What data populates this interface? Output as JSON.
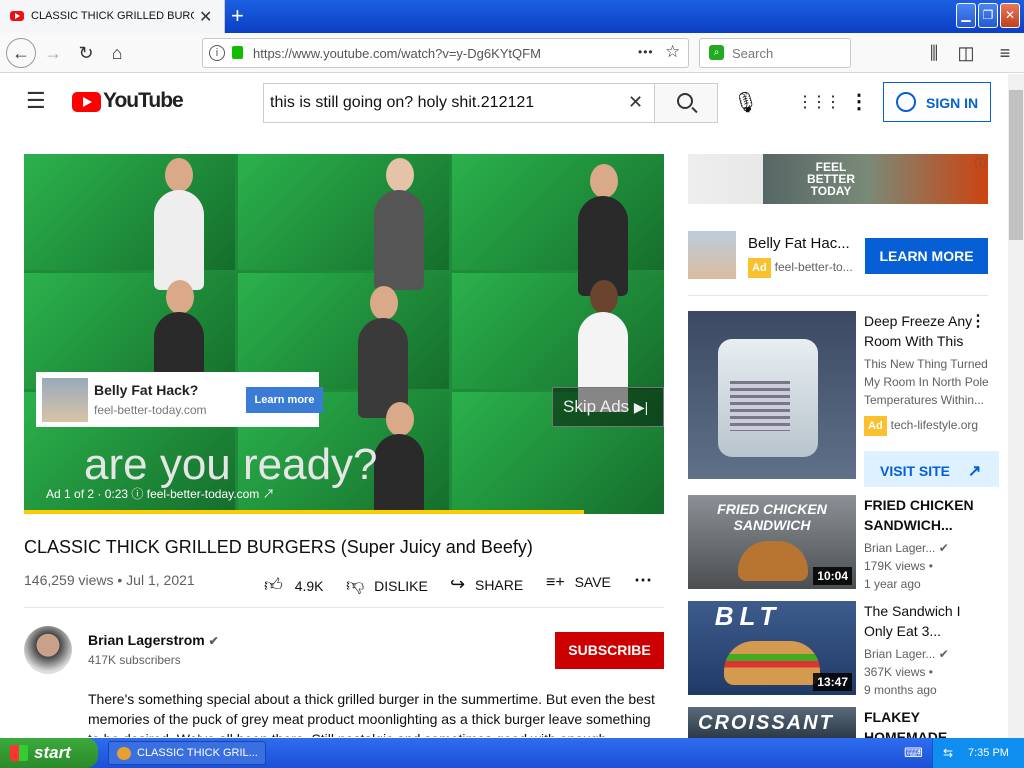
{
  "browser": {
    "tab_title": "CLASSIC THICK GRILLED BURGERS (Super Juicy and Beefy) - YouTube",
    "new_tab_icon": "+",
    "url": "https://www.youtube.com/watch?v=y-Dg6KYtQFM",
    "search_placeholder": "Search",
    "more_dots": "•••"
  },
  "youtube": {
    "logo_text": "YouTube",
    "search_query": "this is still going on? holy shit.212121",
    "sign_in": "SIGN IN"
  },
  "video_ad": {
    "card_title": "Belly Fat Hack?",
    "card_url": "feel-better-today.com",
    "card_button": "Learn more",
    "skip": "Skip Ads",
    "overlay_text": "are you ready?",
    "ad_info": "Ad 1 of 2 · 0:23",
    "ad_domain": "feel-better-today.com",
    "progress": 0.875
  },
  "video": {
    "title": "CLASSIC THICK GRILLED BURGERS (Super Juicy and Beefy)",
    "meta": "146,259 views • Jul 1, 2021",
    "likes": "4.9K",
    "dislike": "DISLIKE",
    "share": "SHARE",
    "save": "SAVE",
    "channel": "Brian Lagerstrom",
    "subscribers": "417K subscribers",
    "subscribe": "SUBSCRIBE",
    "description": "There's something special about a thick grilled burger in the summertime. But even the best memories of the puck of grey meat product moonlighting as a thick burger leave something to be desired. We've all been there. Still nostalgic and sometimes good with enough toppings..."
  },
  "sidebar": {
    "banner_text": "FEEL BETTER TODAY",
    "ad1": {
      "title": "Belly Fat Hac...",
      "badge": "Ad",
      "url": "feel-better-to...",
      "button": "LEARN MORE"
    },
    "ad2": {
      "title": "Deep Freeze Any Room With This",
      "desc": "This New Thing Turned My Room In North Pole Temperatures Within...",
      "badge": "Ad",
      "url": "tech-lifestyle.org",
      "button": "VISIT SITE"
    },
    "videos": [
      {
        "thumb_text": "FRIED CHICKEN SANDWICH",
        "title": "FRIED CHICKEN SANDWICH...",
        "channel": "Brian Lager...",
        "views": "179K views •",
        "age": "1 year ago",
        "duration": "10:04"
      },
      {
        "thumb_text": "BLT",
        "title": "The Sandwich I Only Eat 3...",
        "channel": "Brian Lager...",
        "views": "367K views •",
        "age": "9 months ago",
        "duration": "13:47"
      },
      {
        "thumb_text": "CROISSANT",
        "title": "FLAKEY HOMEMADE",
        "channel": "",
        "views": "",
        "age": "",
        "duration": ""
      }
    ]
  },
  "taskbar": {
    "start": "start",
    "item": "CLASSIC THICK GRIL...",
    "time": "7:35 PM"
  },
  "colors": {
    "accent": "#065fd4",
    "subscribe": "#cc0000",
    "ad_badge": "#fbc02d"
  }
}
